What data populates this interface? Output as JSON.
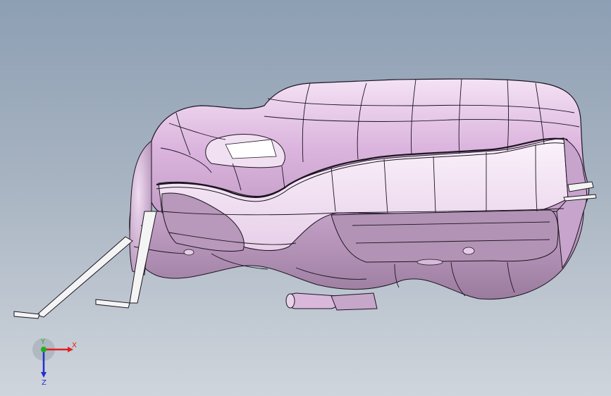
{
  "viewport": {
    "background_top": "#8d9fb4",
    "background_bottom": "#cfd5dc"
  },
  "model": {
    "part_color": "#e6c3e8",
    "shade_color": "#b08fb3",
    "edge_color": "#1c1420"
  },
  "triad": {
    "x_label": "X",
    "y_label": "Y",
    "z_label": "Z",
    "x_color": "#e02020",
    "y_color": "#20b020",
    "z_color": "#2030d0"
  }
}
